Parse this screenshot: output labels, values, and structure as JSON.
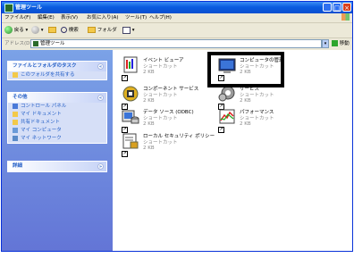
{
  "window": {
    "title": "管理ツール"
  },
  "menu": [
    "ファイル(F)",
    "編集(E)",
    "表示(V)",
    "お気に入り(A)",
    "ツール(T)",
    "ヘルプ(H)"
  ],
  "toolbar": {
    "back": "戻る",
    "search": "検索",
    "folders": "フォルダ"
  },
  "address": {
    "label": "アドレス(D)",
    "value": "管理ツール",
    "go": "移動"
  },
  "sidebar": {
    "tasks": {
      "title": "ファイルとフォルダのタスク",
      "items": [
        "このフォルダを共有する"
      ]
    },
    "other": {
      "title": "その他",
      "items": [
        "コントロール パネル",
        "マイ ドキュメント",
        "共有ドキュメント",
        "マイ コンピュータ",
        "マイ ネットワーク"
      ]
    },
    "details": {
      "title": "詳細"
    }
  },
  "files": [
    {
      "name": "イベント ビューア",
      "type": "ショートカット",
      "size": "2 KB"
    },
    {
      "name": "コンピュータの管理",
      "type": "ショートカット",
      "size": "2 KB"
    },
    {
      "name": "コンポーネント サービス",
      "type": "ショートカット",
      "size": "2 KB"
    },
    {
      "name": "サービス",
      "type": "ショートカット",
      "size": "2 KB"
    },
    {
      "name": "データ ソース (ODBC)",
      "type": "ショートカット",
      "size": "2 KB"
    },
    {
      "name": "パフォーマンス",
      "type": "ショートカット",
      "size": "2 KB"
    },
    {
      "name": "ローカル セキュリティ ポリシー",
      "type": "ショートカット",
      "size": "2 KB"
    }
  ]
}
